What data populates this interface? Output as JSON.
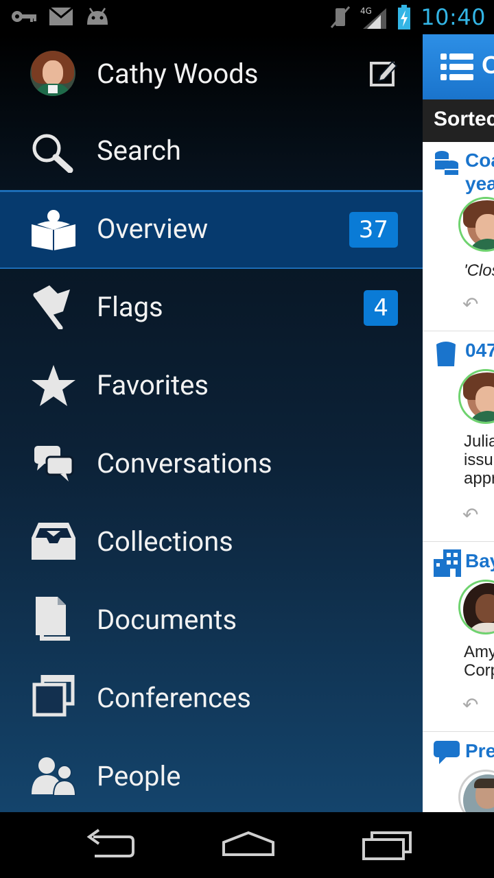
{
  "status": {
    "time": "10:40",
    "network": "4G"
  },
  "drawer": {
    "user": {
      "name": "Cathy Woods"
    },
    "items": [
      {
        "label": "Search",
        "icon": "search-icon"
      },
      {
        "label": "Overview",
        "icon": "reader-icon",
        "badge": "37",
        "active": true
      },
      {
        "label": "Flags",
        "icon": "flag-icon",
        "badge": "4"
      },
      {
        "label": "Favorites",
        "icon": "star-icon"
      },
      {
        "label": "Conversations",
        "icon": "chat-bubbles-icon"
      },
      {
        "label": "Collections",
        "icon": "inbox-tray-icon"
      },
      {
        "label": "Documents",
        "icon": "documents-icon"
      },
      {
        "label": "Conferences",
        "icon": "windows-icon"
      },
      {
        "label": "People",
        "icon": "people-icon"
      }
    ]
  },
  "content": {
    "header_title": "O",
    "sort_label": "Sortec",
    "items": [
      {
        "title_line1": "Coa",
        "title_line2": "yea",
        "text_line1": "'Clos",
        "icon": "coins-stack-icon"
      },
      {
        "title_line1": "047",
        "text_line1": "Julia",
        "text_line2": "issu",
        "text_line3": "appr",
        "icon": "phone-icon"
      },
      {
        "title_line1": "Bay",
        "text_line1": "Amy",
        "text_line2": "Corp",
        "icon": "buildings-icon"
      },
      {
        "title_line1": "Pre",
        "icon": "speech-bubble-icon"
      }
    ]
  },
  "colors": {
    "accent": "#33b5e5",
    "badge": "#0a7bd6",
    "active_row": "#063a6e",
    "link_blue": "#1a74cc"
  }
}
